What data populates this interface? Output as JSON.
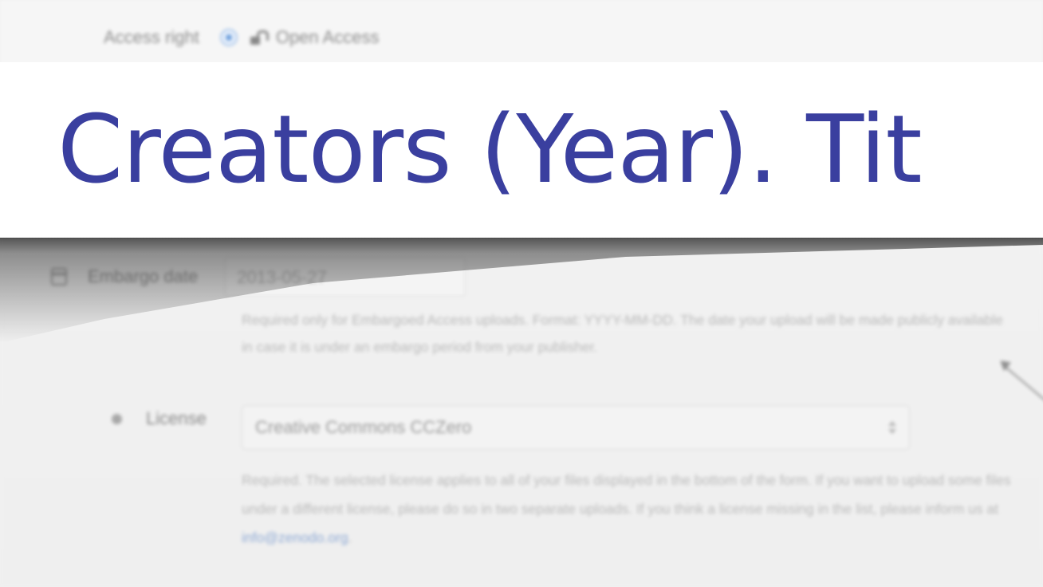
{
  "access": {
    "label": "Access right",
    "value": "Open Access"
  },
  "embargo": {
    "label": "Embargo date",
    "value": "2013-05-27",
    "help": "Required only for Embargoed Access uploads. Format: YYYY-MM-DD. The date your upload will be made publicly available in case it is under an embargo period from your publisher."
  },
  "license": {
    "label": "License",
    "selected": "Creative Commons CCZero",
    "help_before": "Required. The selected license applies to all of your files displayed in the bottom of the form. If you want to upload some files under a different license, please do so in two separate uploads. If you think a license missing in the list, please inform us at ",
    "help_email": "info@zenodo.org",
    "help_after": "."
  },
  "banner": {
    "text": "Creators (Year). Tit"
  },
  "colors": {
    "banner_text": "#3a3f9f",
    "link": "#8ea9d4",
    "background": "#f1f1f1"
  }
}
